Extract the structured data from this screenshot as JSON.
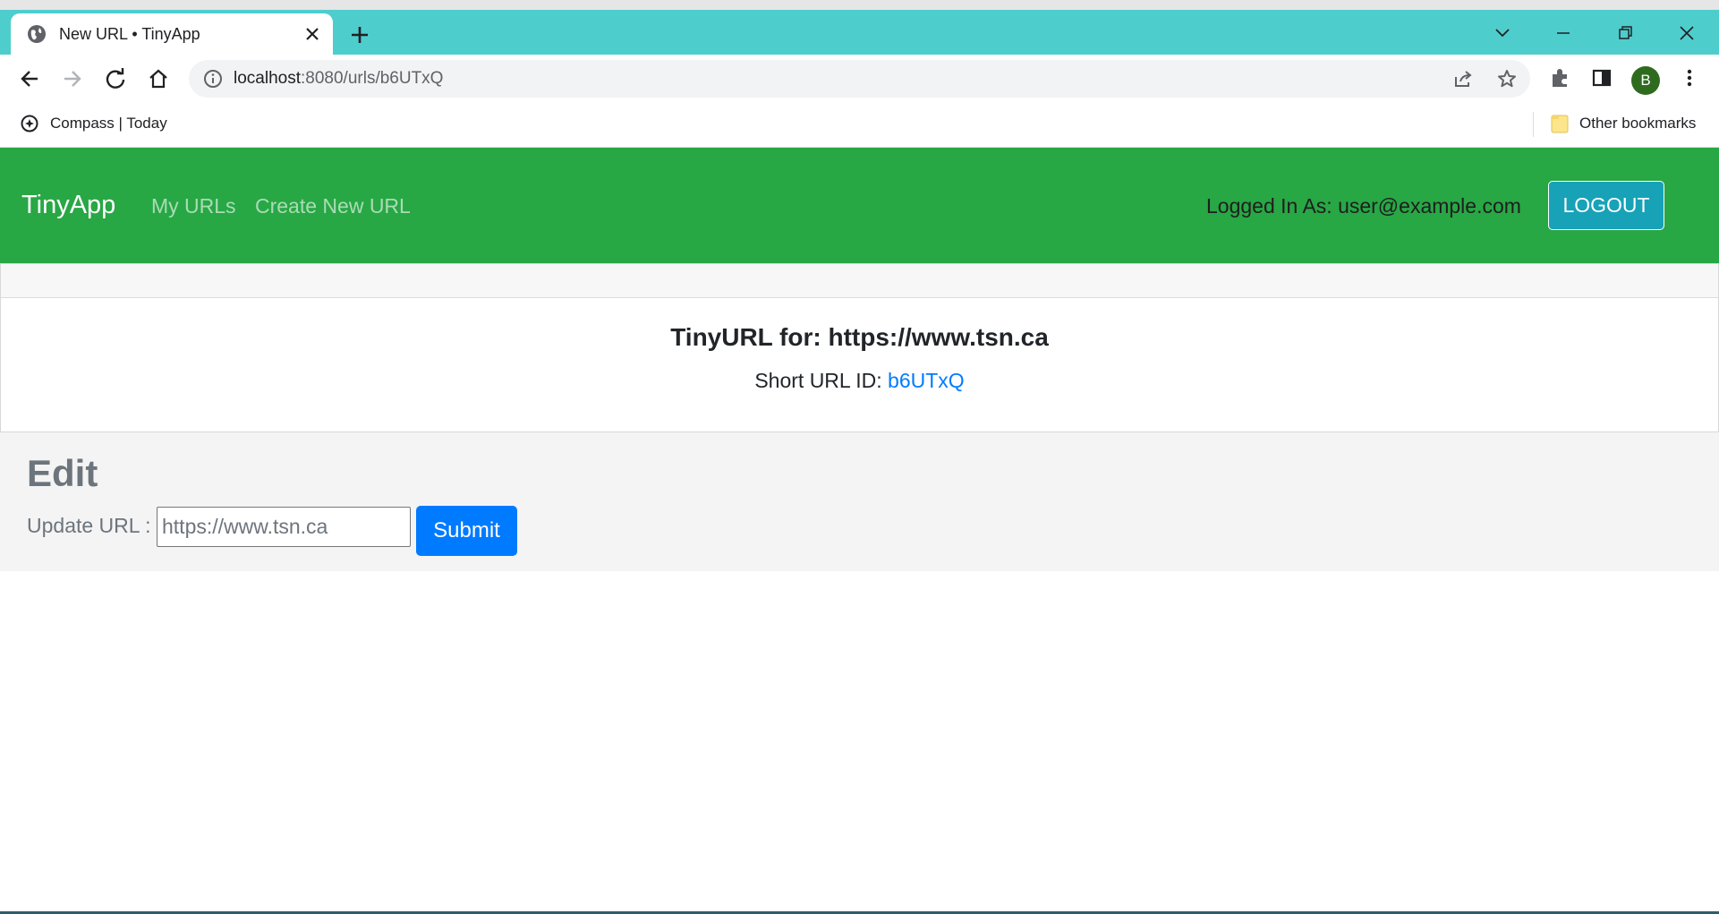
{
  "browser": {
    "tab_title": "New URL • TinyApp",
    "url_host": "localhost",
    "url_path": ":8080/urls/b6UTxQ",
    "profile_initial": "B",
    "bookmarks": {
      "item1": "Compass | Today",
      "other": "Other bookmarks"
    }
  },
  "nav": {
    "brand": "TinyApp",
    "links": [
      "My URLs",
      "Create New URL"
    ],
    "logged_in": "Logged In As: user@example.com",
    "logout": "LOGOUT"
  },
  "card": {
    "title": "TinyURL for: https://www.tsn.ca",
    "short_prefix": "Short URL ID: ",
    "short_id": "b6UTxQ"
  },
  "edit": {
    "heading": "Edit",
    "label": "Update URL :",
    "placeholder": "https://www.tsn.ca",
    "submit": "Submit"
  },
  "colors": {
    "tabbar": "#4ecdcd",
    "navbar": "#28a745",
    "logout": "#17a2b8",
    "submit": "#007bff"
  }
}
